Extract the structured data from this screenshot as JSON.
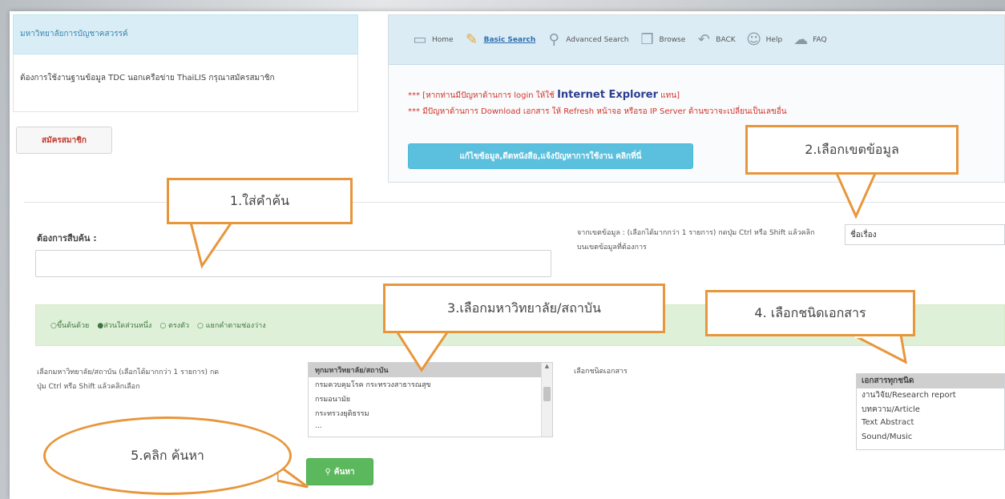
{
  "university": {
    "name": "มหาวิทยาลัยการบัญชาคสวรรค์"
  },
  "info": {
    "text": "ต้องการใช้งานฐานข้อมูล TDC นอกเครือข่าย ThaiLIS กรุณาสมัครสมาชิก"
  },
  "register": {
    "label": "สมัครสมาชิก"
  },
  "nav": {
    "items": [
      {
        "label": "Home",
        "icon": "home-icon",
        "active": false
      },
      {
        "label": "Basic Search",
        "icon": "search-doc-icon",
        "active": true
      },
      {
        "label": "Advanced Search",
        "icon": "advanced-search-icon",
        "active": false
      },
      {
        "label": "Browse",
        "icon": "browse-icon",
        "active": false
      },
      {
        "label": "BACK",
        "icon": "back-arrow-icon",
        "active": false
      },
      {
        "label": "Help",
        "icon": "help-icon",
        "active": false
      },
      {
        "label": "FAQ",
        "icon": "faq-icon",
        "active": false
      }
    ]
  },
  "notice": {
    "line1_prefix": "*** [หากท่านมีปัญหาด้านการ login ให้ใช้",
    "line1_highlight": "Internet Explorer",
    "line1_suffix": "แทน]",
    "line2": "*** มีปัญหาด้านการ Download เอกสาร ให้ Refresh หน้าจอ หรือรอ IP Server ด้านขวาจะเปลี่ยนเป็นเลขอื่น"
  },
  "manual_button": {
    "label": "แก้ไขข้อมูล,ดีตหนังสือ,แจ้งปัญหาการใช้งาน คลิกที่นี่"
  },
  "search": {
    "label": "ต้องการสืบค้น :",
    "placeholder": "",
    "field_label": "จากเขตข้อมูล : (เลือกได้มากกว่า 1 รายการ) กดปุ่ม Ctrl หรือ Shift แล้วคลิกบนเขตข้อมูลที่ต้องการ",
    "field_selected": "ชื่อเรื่อง",
    "button_label": "ค้นหา"
  },
  "match_options": [
    "ขึ้นต้นด้วย",
    "ส่วนใดส่วนหนึ่ง",
    "ตรงตัว",
    "แยกคำตามช่องว่าง"
  ],
  "match_selected": 1,
  "institution": {
    "label": "เลือกมหาวิทยาลัย/สถาบัน (เลือกได้มากกว่า 1 รายการ) กดปุ่ม Ctrl หรือ Shift แล้วคลิกเลือก",
    "options": [
      "ทุกมหาวิทยาลัย/สถาบัน",
      "กรมควบคุมโรค กระทรวงสาธารณสุข",
      "กรมอนามัย",
      "กระทรวงยุติธรรม",
      "..."
    ]
  },
  "doctype": {
    "label": "เลือกชนิดเอกสาร",
    "options": [
      "เอกสารทุกชนิด",
      "งานวิจัย/Research report",
      "บทความ/Article",
      "Text Abstract",
      "Sound/Music"
    ]
  },
  "callouts": {
    "c1": "1.ใส่คำค้น",
    "c2": "2.เลือกเขตข้อมูล",
    "c3": "3.เลือกมหาวิทยาลัย/สถาบัน",
    "c4": "4. เลือกชนิดเอกสาร",
    "c5": "5.คลิก ค้นหา"
  },
  "colors": {
    "callout_border": "#e8963b",
    "info_button": "#5bc0de",
    "search_button": "#5cb85c",
    "notice": "#d0342c"
  }
}
